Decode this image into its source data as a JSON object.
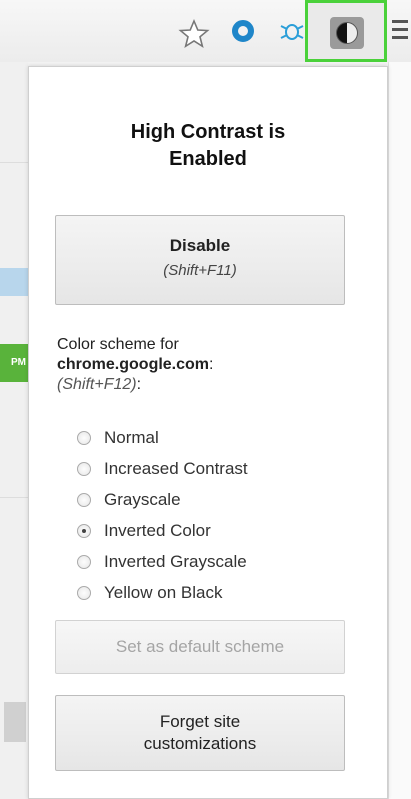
{
  "toolbar": {
    "icons": [
      "star-icon",
      "opera-o-icon",
      "bug-icon",
      "high-contrast-icon",
      "menu-icon"
    ],
    "accent": "#4ad13a"
  },
  "background": {
    "badge_text": "PM"
  },
  "popup": {
    "title_line1": "High Contrast is",
    "title_line2": "Enabled",
    "disable_button": {
      "label": "Disable",
      "shortcut": "(Shift+F11)"
    },
    "scheme_intro": "Color scheme for",
    "site": "chrome.google.com",
    "site_suffix": ":",
    "scheme_shortcut": "(Shift+F12)",
    "scheme_shortcut_suffix": ":",
    "schemes": [
      {
        "label": "Normal",
        "checked": false
      },
      {
        "label": "Increased Contrast",
        "checked": false
      },
      {
        "label": "Grayscale",
        "checked": false
      },
      {
        "label": "Inverted Color",
        "checked": true
      },
      {
        "label": "Inverted Grayscale",
        "checked": false
      },
      {
        "label": "Yellow on Black",
        "checked": false
      }
    ],
    "default_button": "Set as default scheme",
    "forget_button_line1": "Forget site",
    "forget_button_line2": "customizations"
  }
}
